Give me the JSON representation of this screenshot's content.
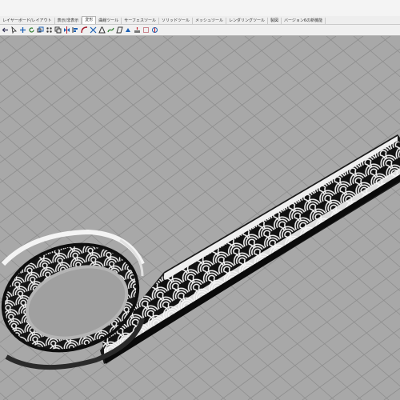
{
  "tabs": [
    {
      "label": "レイヤーボード/レイアウト",
      "active": false
    },
    {
      "label": "表示/非表示",
      "active": false
    },
    {
      "label": "変形",
      "active": true
    },
    {
      "label": "曲線ツール",
      "active": false
    },
    {
      "label": "サーフェスツール",
      "active": false
    },
    {
      "label": "ソリッドツール",
      "active": false
    },
    {
      "label": "メッシュツール",
      "active": false
    },
    {
      "label": "レンダリングツール",
      "active": false
    },
    {
      "label": "製図",
      "active": false
    },
    {
      "label": "バージョン6の新機能",
      "active": false
    }
  ],
  "toolbar": {
    "icons": [
      "back-arrow-icon",
      "select-icon",
      "move-icon",
      "rotate-icon",
      "scale-icon",
      "array-icon",
      "copy-icon",
      "mirror-icon",
      "align-icon",
      "bend-icon",
      "twist-icon",
      "taper-icon",
      "flow-icon",
      "shear-icon",
      "orient-icon",
      "smash-icon",
      "cage-icon",
      "morph-icon"
    ]
  },
  "viewport": {
    "name": "perspective-viewport",
    "background_color": "#a8a8a8",
    "grid_color": "#8e8e8e",
    "grid": true
  },
  "colors": {
    "model_light": "#f2f2f2",
    "model_shadow": "#1a1a1a",
    "band_edge": "#0d0d0d"
  }
}
